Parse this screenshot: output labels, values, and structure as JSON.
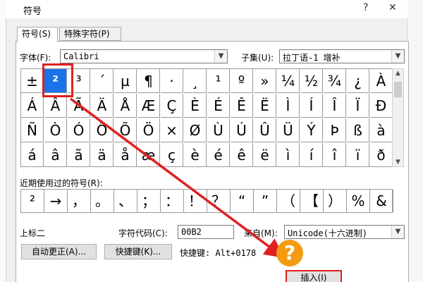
{
  "window": {
    "title": "符号",
    "help": "?",
    "close": "✕"
  },
  "tabs": [
    {
      "label": "符号(S)"
    },
    {
      "label": "特殊字符(P)"
    }
  ],
  "font": {
    "label": "字体(F):",
    "value": "Calibri"
  },
  "subset": {
    "label": "子集(U):",
    "value": "拉丁语-1 增补"
  },
  "grid_rows": [
    [
      "±",
      "²",
      "³",
      "´",
      "µ",
      "¶",
      "·",
      "¸",
      "¹",
      "º",
      "»",
      "¼",
      "½",
      "¾",
      "¿",
      "À"
    ],
    [
      "Á",
      "Â",
      "Ã",
      "Ä",
      "Å",
      "Æ",
      "Ç",
      "È",
      "É",
      "Ê",
      "Ë",
      "Ì",
      "Í",
      "Î",
      "Ï",
      "Đ"
    ],
    [
      "Ñ",
      "Ò",
      "Ó",
      "Ô",
      "Õ",
      "Ö",
      "×",
      "Ø",
      "Ù",
      "Ú",
      "Û",
      "Ü",
      "Ý",
      "Þ",
      "ß",
      "à"
    ],
    [
      "á",
      "â",
      "ã",
      "ä",
      "å",
      "æ",
      "ç",
      "è",
      "é",
      "ê",
      "ë",
      "ì",
      "í",
      "î",
      "ï",
      "ð"
    ]
  ],
  "recent": {
    "label": "近期使用过的符号(R):",
    "symbols": [
      "²",
      "→",
      "，",
      "。",
      "、",
      "；",
      "：",
      "！",
      "？",
      "“",
      "”",
      "（",
      "【",
      "）",
      "%",
      "&"
    ]
  },
  "char_name": "上标二",
  "char_code": {
    "label": "字符代码(C):",
    "value": "00B2"
  },
  "from": {
    "label": "来自(M):",
    "value": "Unicode(十六进制)"
  },
  "autocorrect_button": "自动更正(A)...",
  "shortcut_button": "快捷键(K)...",
  "shortcut_text": "快捷键: Alt+0178",
  "insert_button": "插入(I)",
  "annotation_mark": "?",
  "colors": {
    "selected": "#1a73e8",
    "highlight": "#e02020",
    "badge": "#f39c12"
  }
}
